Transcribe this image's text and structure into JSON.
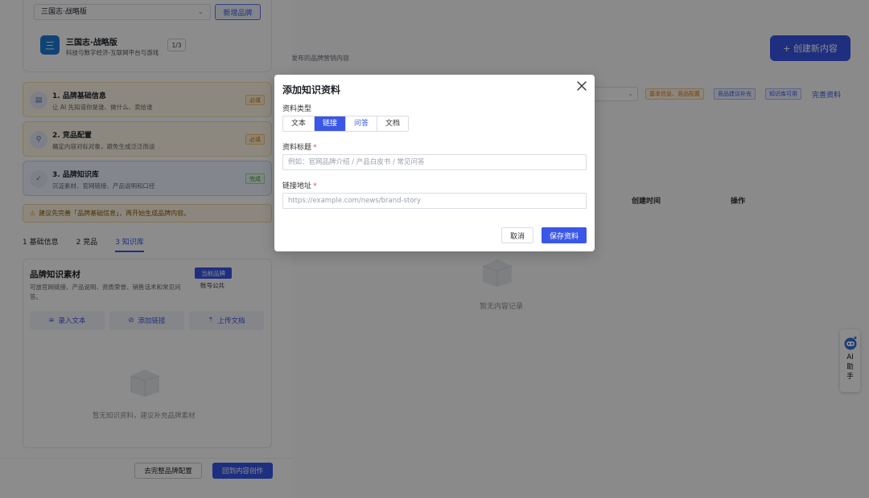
{
  "colors": {
    "accent": "#3a57e8",
    "overlay": "rgba(0,0,0,0.45)",
    "warning": "#e08a00",
    "success": "#2f9a3f"
  },
  "brand_panel": {
    "selected_brand": "三国志·战略版",
    "new_brand_label": "新增品牌",
    "brand_name": "三国志·战略版",
    "brand_desc": "科技与数字经济-互联网平台与游戏",
    "brand_count": "1/3",
    "brand_icon_glyph": "三"
  },
  "steps": [
    {
      "title": "1. 品牌基础信息",
      "desc": "让 AI 先知道你是谁、做什么、卖给谁",
      "badge": "必填",
      "icon": "document-icon"
    },
    {
      "title": "2. 竞品配置",
      "desc": "确定内容对标对象，避免生成泛泛而谈",
      "badge": "必填",
      "icon": "target-icon"
    },
    {
      "title": "3. 品牌知识库",
      "desc": "沉淀素材、官网链接、产品说明和口径",
      "badge": "完成",
      "icon": "check-icon"
    }
  ],
  "warning": {
    "icon": "warning-icon",
    "text": "建议先完善「品牌基础信息」，再开始生成品牌内容。"
  },
  "tabs": [
    {
      "label": "1 基础信息"
    },
    {
      "label": "2 竞品"
    },
    {
      "label": "3 知识库"
    }
  ],
  "knowledge": {
    "title": "品牌知识素材",
    "desc": "可放官网链接、产品说明、资质荣誉、销售话术和常见问答。",
    "badge": "当前品牌",
    "scope": "账号公共",
    "actions": [
      {
        "label": "录入文本"
      },
      {
        "label": "添加链接"
      },
      {
        "label": "上传文档"
      }
    ],
    "empty_text": "暂无知识资料，建议补充品牌素材"
  },
  "footer": {
    "complete_label": "去完整品牌配置",
    "back_label": "回到内容创作"
  },
  "right": {
    "create_label": "+ 创建新内容",
    "subtitle": "发布的品牌营销内容",
    "tags": [
      "基本信息、竞品配置",
      "竞品建议补充",
      "知识库可用"
    ],
    "tag_link": "完善资料",
    "col_created": "创建时间",
    "col_ops": "操作",
    "empty_text": "暂无内容记录"
  },
  "ai_helper": {
    "label": "AI助手"
  },
  "modal": {
    "title": "添加知识资料",
    "type_label": "资料类型",
    "types": [
      {
        "label": "文本"
      },
      {
        "label": "链接"
      },
      {
        "label": "问答"
      },
      {
        "label": "文档"
      }
    ],
    "selected_type": "链接",
    "title_label": "资料标题",
    "title_placeholder": "例如：官网品牌介绍 / 产品白皮书 / 常见问答",
    "url_label": "链接地址",
    "url_placeholder": "https://example.com/news/brand-story",
    "required_mark": "*",
    "cancel_label": "取消",
    "save_label": "保存资料"
  }
}
